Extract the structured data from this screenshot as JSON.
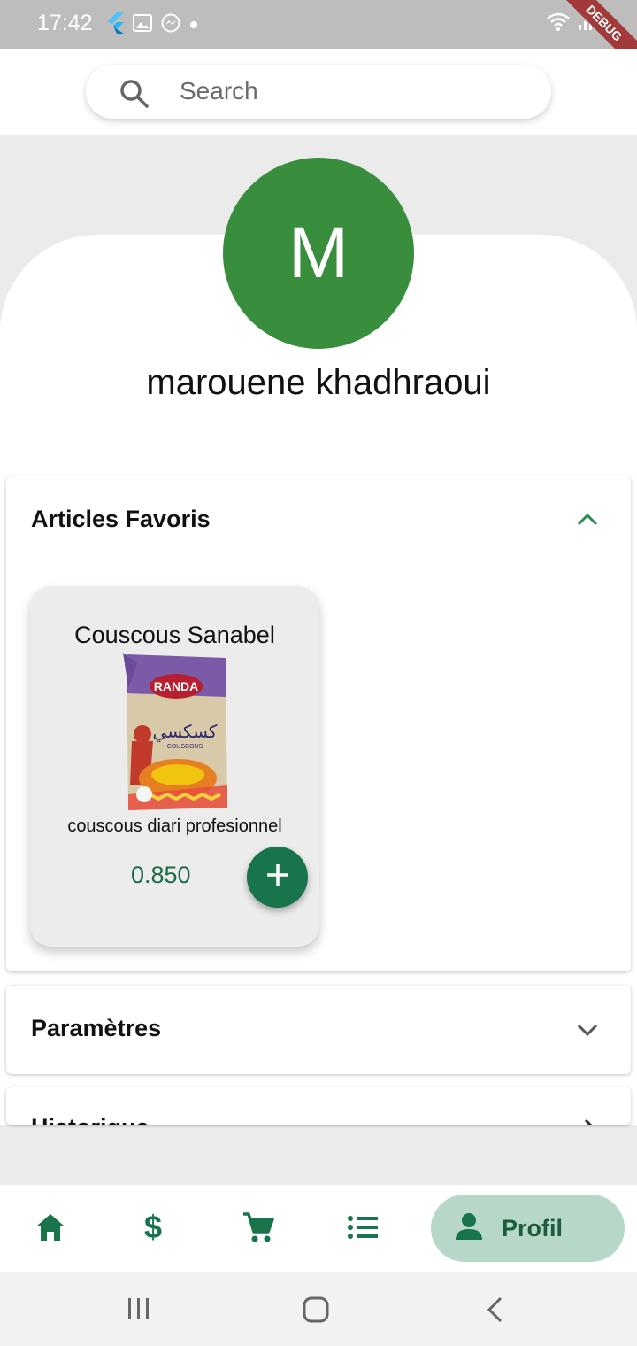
{
  "status_bar": {
    "time": "17:42",
    "left_icons": [
      "flutter-icon",
      "image-icon",
      "messenger-icon",
      "dot-icon"
    ],
    "right_icons": [
      "wifi-icon",
      "signal-icon",
      "battery-icon"
    ],
    "debug_label": "DEBUG"
  },
  "search": {
    "placeholder": "Search",
    "icon": "search-icon"
  },
  "profile": {
    "avatar_letter": "M",
    "avatar_color": "#388e3c",
    "name": "marouene khadhraoui"
  },
  "sections": {
    "favorites": {
      "title": "Articles Favoris",
      "expanded": true,
      "items": [
        {
          "name": "Couscous Sanabel",
          "description": "couscous diari profesionnel",
          "price": "0.850",
          "image_brand_text": "RANDA",
          "image_arabic_text": "كسكسي",
          "image_caption": "COUSCOUS"
        }
      ]
    },
    "settings": {
      "title": "Paramètres",
      "expanded": false
    },
    "history": {
      "title": "Historique"
    }
  },
  "bottom_nav": {
    "items": [
      {
        "icon": "home-icon"
      },
      {
        "icon": "dollar-icon"
      },
      {
        "icon": "cart-icon"
      },
      {
        "icon": "list-icon"
      }
    ],
    "active": {
      "icon": "person-icon",
      "label": "Profil"
    }
  },
  "colors": {
    "accent": "#18744a",
    "active_pill": "#b7d8c8",
    "chevron_up": "#2e8b57"
  }
}
